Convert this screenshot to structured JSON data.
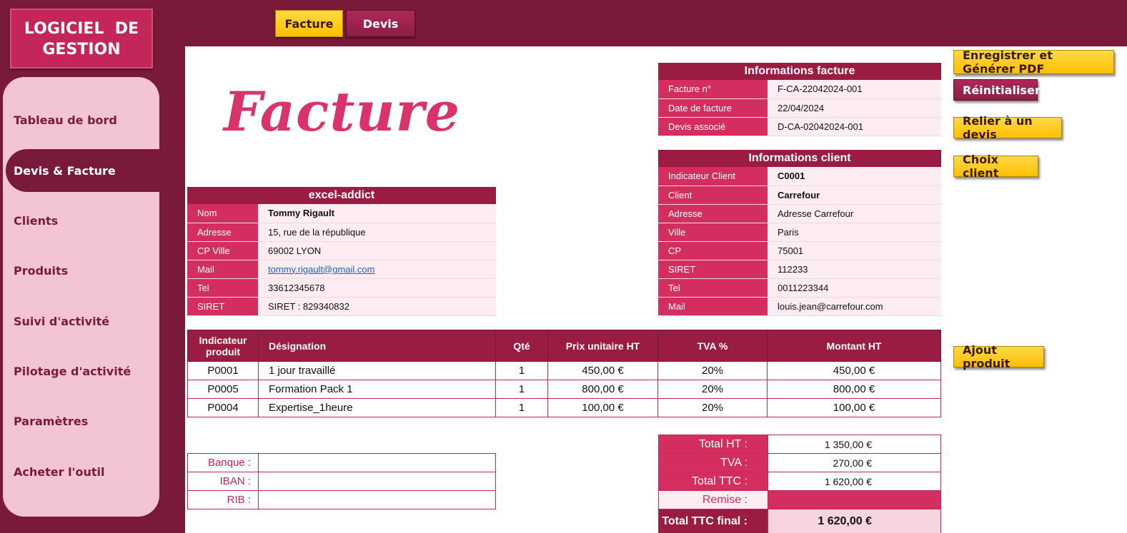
{
  "logo": {
    "line1": "LOGICIEL  DE",
    "line2": "GESTION"
  },
  "sidebar": {
    "items": [
      {
        "label": "Tableau de bord",
        "active": false
      },
      {
        "label": "Devis & Facture",
        "active": true
      },
      {
        "label": "Clients",
        "active": false
      },
      {
        "label": "Produits",
        "active": false
      },
      {
        "label": "Suivi d'activité",
        "active": false
      },
      {
        "label": "Pilotage d'activité",
        "active": false
      },
      {
        "label": "Paramètres",
        "active": false
      },
      {
        "label": "Acheter l'outil",
        "active": false
      }
    ]
  },
  "tabs": {
    "facture": "Facture",
    "devis": "Devis"
  },
  "page_title": "Facture",
  "company": {
    "header": "excel-addict",
    "rows": [
      {
        "label": "Nom",
        "value": "Tommy Rigault"
      },
      {
        "label": "Adresse",
        "value": "15, rue de la république"
      },
      {
        "label": "CP Ville",
        "value": "69002 LYON"
      },
      {
        "label": "Mail",
        "value": "tommy.rigault@gmail.com"
      },
      {
        "label": "Tel",
        "value": "33612345678"
      },
      {
        "label": "SIRET",
        "value": "SIRET : 829340832"
      }
    ]
  },
  "invoice_info": {
    "header": "Informations facture",
    "rows": [
      {
        "label": "Facture n°",
        "value": "F-CA-22042024-001"
      },
      {
        "label": "Date de facture",
        "value": "22/04/2024"
      },
      {
        "label": "Devis associé",
        "value": "D-CA-02042024-001"
      }
    ]
  },
  "client_info": {
    "header": "Informations client",
    "rows": [
      {
        "label": "Indicateur Client",
        "value": "C0001"
      },
      {
        "label": "Client",
        "value": "Carrefour"
      },
      {
        "label": "Adresse",
        "value": "Adresse Carrefour"
      },
      {
        "label": "Ville",
        "value": "Paris"
      },
      {
        "label": "CP",
        "value": "75001"
      },
      {
        "label": "SIRET",
        "value": "112233"
      },
      {
        "label": "Tel",
        "value": "0011223344"
      },
      {
        "label": "Mail",
        "value": "louis.jean@carrefour.com"
      }
    ]
  },
  "products": {
    "columns": [
      "Indicateur produit",
      "Désignation",
      "Qté",
      "Prix unitaire HT",
      "TVA %",
      "Montant HT"
    ],
    "rows": [
      [
        "P0001",
        "1 jour travaillé",
        "1",
        "450,00 €",
        "20%",
        "450,00 €"
      ],
      [
        "P0005",
        "Formation Pack 1",
        "1",
        "800,00 €",
        "20%",
        "800,00 €"
      ],
      [
        "P0004",
        "Expertise_1heure",
        "1",
        "100,00 €",
        "20%",
        "100,00 €"
      ]
    ]
  },
  "bank": {
    "banque": "Banque :",
    "iban": "IBAN :",
    "rib": "RIB :"
  },
  "totals": {
    "total_ht_label": "Total HT :",
    "total_ht": "1 350,00 €",
    "tva_label": "TVA :",
    "tva": "270,00 €",
    "total_ttc_label": "Total TTC :",
    "total_ttc": "1 620,00 €",
    "remise_label": "Remise :",
    "remise": "",
    "final_label": "Total TTC final :",
    "final": "1 620,00 €"
  },
  "buttons": {
    "save_pdf": "Enregistrer et Générer PDF",
    "reset": "Réinitialiser",
    "link_quote": "Relier à un devis",
    "choose_client": "Choix client",
    "add_product": "Ajout produit"
  }
}
